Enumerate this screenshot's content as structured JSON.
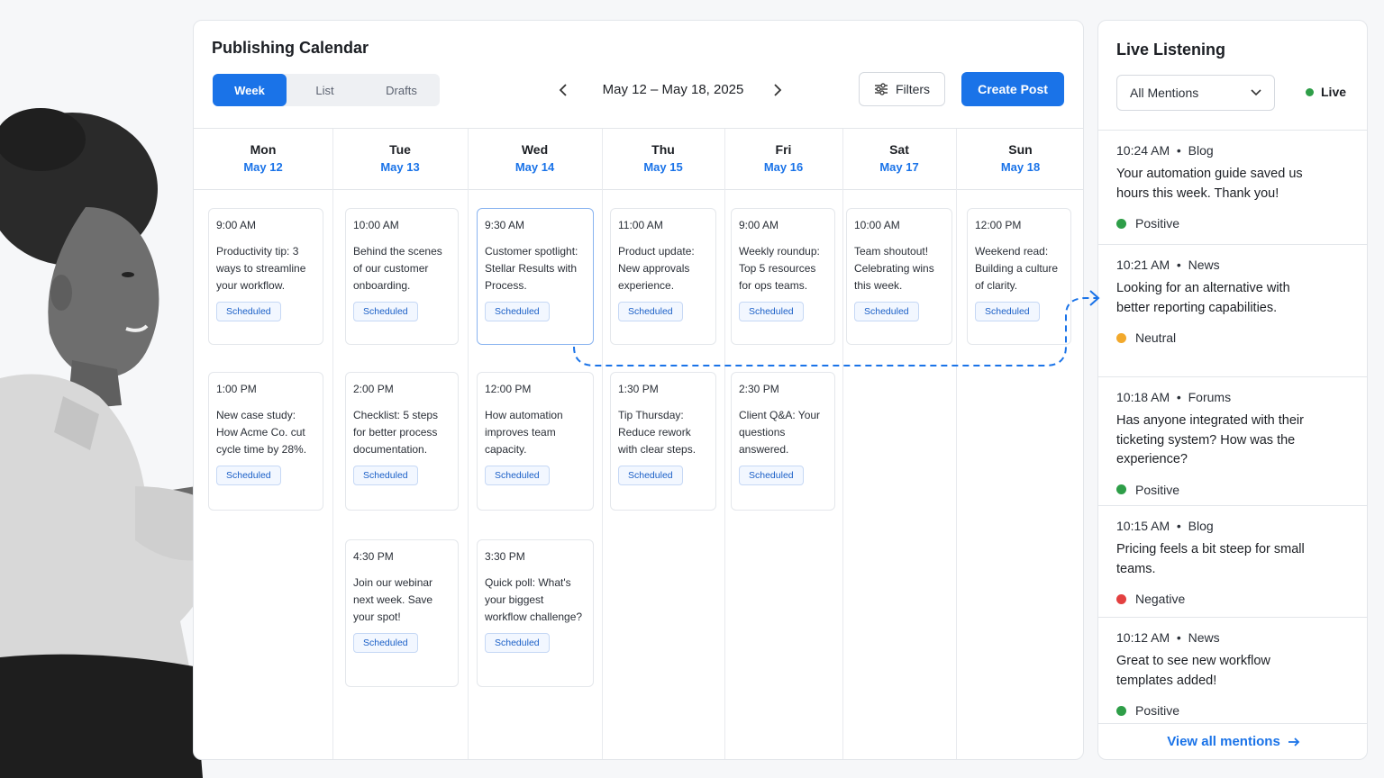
{
  "calendar": {
    "title": "Publishing Calendar",
    "view_tabs": [
      {
        "label": "Week",
        "active": true
      },
      {
        "label": "List",
        "active": false
      },
      {
        "label": "Drafts",
        "active": false
      }
    ],
    "date_range": "May 12 – May 18, 2025",
    "filters_label": "Filters",
    "create_label": "Create Post",
    "days": [
      {
        "name": "Mon",
        "date": "May 12"
      },
      {
        "name": "Tue",
        "date": "May 13"
      },
      {
        "name": "Wed",
        "date": "May 14"
      },
      {
        "name": "Thu",
        "date": "May 15"
      },
      {
        "name": "Fri",
        "date": "May 16"
      },
      {
        "name": "Sat",
        "date": "May 17"
      },
      {
        "name": "Sun",
        "date": "May 18"
      }
    ],
    "posts": [
      {
        "day": 0,
        "row": 0,
        "time": "9:00 AM",
        "text": "Productivity tip: 3 ways to streamline your workflow.",
        "status": "Scheduled"
      },
      {
        "day": 1,
        "row": 0,
        "time": "10:00 AM",
        "text": "Behind the scenes of our customer onboarding.",
        "status": "Scheduled"
      },
      {
        "day": 2,
        "row": 0,
        "time": "9:30 AM",
        "text": "Customer spotlight: Stellar Results with Process.",
        "status": "Scheduled",
        "selected": true
      },
      {
        "day": 3,
        "row": 0,
        "time": "11:00 AM",
        "text": "Product update: New approvals experience.",
        "status": "Scheduled"
      },
      {
        "day": 4,
        "row": 0,
        "time": "9:00 AM",
        "text": "Weekly roundup: Top 5 resources for ops teams.",
        "status": "Scheduled"
      },
      {
        "day": 5,
        "row": 0,
        "time": "10:00 AM",
        "text": "Team shoutout! Celebrating wins this week.",
        "status": "Scheduled"
      },
      {
        "day": 6,
        "row": 0,
        "time": "12:00 PM",
        "text": "Weekend read: Building a culture of clarity.",
        "status": "Scheduled"
      },
      {
        "day": 0,
        "row": 1,
        "time": "1:00 PM",
        "text": "New case study: How Acme Co. cut cycle time by 28%.",
        "status": "Scheduled"
      },
      {
        "day": 1,
        "row": 1,
        "time": "2:00 PM",
        "text": "Checklist: 5 steps for better process documentation.",
        "status": "Scheduled"
      },
      {
        "day": 2,
        "row": 1,
        "time": "12:00 PM",
        "text": "How automation improves team capacity.",
        "status": "Scheduled"
      },
      {
        "day": 3,
        "row": 1,
        "time": "1:30 PM",
        "text": "Tip Thursday: Reduce rework with clear steps.",
        "status": "Scheduled"
      },
      {
        "day": 4,
        "row": 1,
        "time": "2:30 PM",
        "text": "Client Q&A: Your questions answered.",
        "status": "Scheduled"
      },
      {
        "day": 1,
        "row": 2,
        "time": "4:30 PM",
        "text": "Join our webinar next week. Save your spot!",
        "status": "Scheduled"
      },
      {
        "day": 2,
        "row": 2,
        "time": "3:30 PM",
        "text": "Quick poll: What's your biggest workflow challenge?",
        "status": "Scheduled"
      }
    ]
  },
  "listening": {
    "title": "Live Listening",
    "filter_value": "All Mentions",
    "live_label": "Live",
    "mentions": [
      {
        "time": "10:24 AM",
        "source": "Blog",
        "text": "Your automation guide saved us hours this week. Thank you!",
        "sentiment": "Positive"
      },
      {
        "time": "10:21 AM",
        "source": "News",
        "text": "Looking for an alternative with better reporting capabilities.",
        "sentiment": "Neutral"
      },
      {
        "time": "10:18 AM",
        "source": "Forums",
        "text": "Has anyone integrated with their ticketing system? How was the experience?",
        "sentiment": "Positive"
      },
      {
        "time": "10:15 AM",
        "source": "Blog",
        "text": "Pricing feels a bit steep for small teams.",
        "sentiment": "Negative"
      },
      {
        "time": "10:12 AM",
        "source": "News",
        "text": "Great to see new workflow templates added!",
        "sentiment": "Positive"
      }
    ],
    "view_all_label": "View all mentions",
    "sentiment_colors": {
      "Positive": "#2e9e48",
      "Neutral": "#f2a92c",
      "Negative": "#e34040"
    }
  },
  "colors": {
    "accent": "#1a73e8"
  }
}
